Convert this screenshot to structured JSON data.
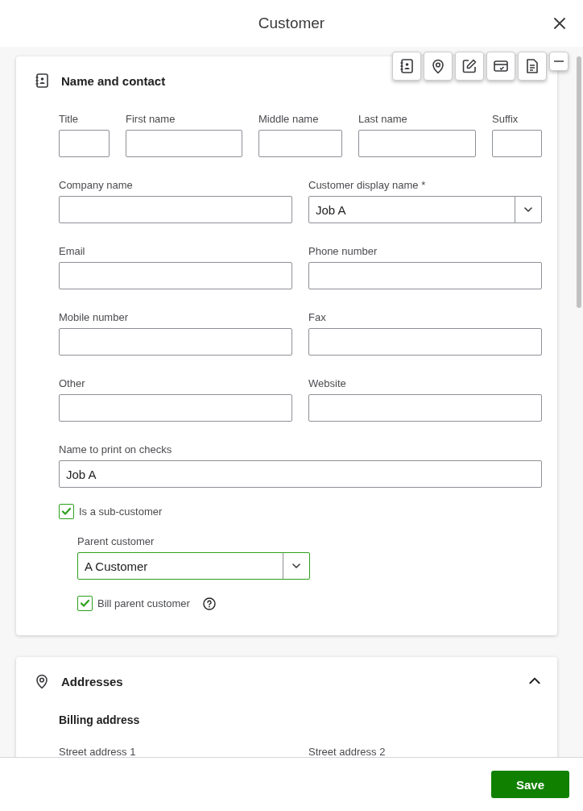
{
  "window": {
    "title": "Customer"
  },
  "name_contact": {
    "title": "Name and contact",
    "name_fields": [
      {
        "label": "Title"
      },
      {
        "label": "First name"
      },
      {
        "label": "Middle name"
      },
      {
        "label": "Last name"
      },
      {
        "label": "Suffix"
      }
    ],
    "pair_fields": [
      {
        "label": "Company name",
        "kind": "text"
      },
      {
        "label": "Customer display name *",
        "kind": "dropdown",
        "value": "Job A"
      },
      {
        "label": "Email",
        "kind": "text"
      },
      {
        "label": "Phone number",
        "kind": "text"
      },
      {
        "label": "Mobile number",
        "kind": "text"
      },
      {
        "label": "Fax",
        "kind": "text"
      },
      {
        "label": "Other",
        "kind": "text"
      },
      {
        "label": "Website",
        "kind": "text"
      }
    ],
    "print_name": {
      "label": "Name to print on checks",
      "value": "Job A"
    },
    "sub_customer": {
      "label": "Is a sub-customer",
      "checked": true
    },
    "parent_customer": {
      "label": "Parent customer",
      "value": "A Customer"
    },
    "bill_parent": {
      "label": "Bill parent customer",
      "checked": true
    }
  },
  "addresses": {
    "title": "Addresses",
    "expanded": true,
    "billing_title": "Billing address",
    "labels": [
      "Street address 1",
      "Street address 2"
    ]
  },
  "footer": {
    "save": "Save"
  }
}
